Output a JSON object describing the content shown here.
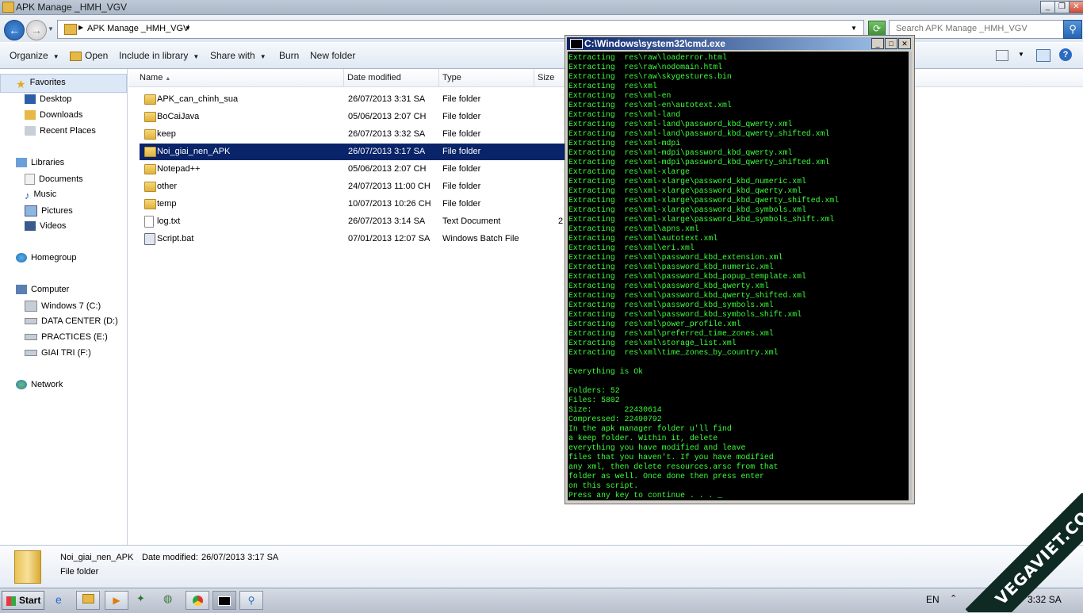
{
  "window": {
    "title": "APK Manage _HMH_VGV"
  },
  "address": {
    "path": "APK Manage _HMH_VGV"
  },
  "search": {
    "placeholder": "Search APK Manage _HMH_VGV"
  },
  "toolbar": {
    "organize": "Organize",
    "open": "Open",
    "include_in_library": "Include in library",
    "share_with": "Share with",
    "burn": "Burn",
    "new_folder": "New folder"
  },
  "nav": {
    "favorites": "Favorites",
    "desktop": "Desktop",
    "downloads": "Downloads",
    "recent_places": "Recent Places",
    "libraries": "Libraries",
    "documents": "Documents",
    "music": "Music",
    "pictures": "Pictures",
    "videos": "Videos",
    "homegroup": "Homegroup",
    "computer": "Computer",
    "drive_c": "Windows 7 (C:)",
    "drive_d": "DATA CENTER (D:)",
    "drive_e": "PRACTICES (E:)",
    "drive_f": "GIAI TRI (F:)",
    "network": "Network"
  },
  "columns": {
    "name": "Name",
    "date": "Date modified",
    "type": "Type",
    "size": "Size"
  },
  "files": [
    {
      "name": "APK_can_chinh_sua",
      "date": "26/07/2013 3:31 SA",
      "type": "File folder",
      "size": ""
    },
    {
      "name": "BoCaiJava",
      "date": "05/06/2013 2:07 CH",
      "type": "File folder",
      "size": ""
    },
    {
      "name": "keep",
      "date": "26/07/2013 3:32 SA",
      "type": "File folder",
      "size": ""
    },
    {
      "name": "Noi_giai_nen_APK",
      "date": "26/07/2013 3:17 SA",
      "type": "File folder",
      "size": ""
    },
    {
      "name": "Notepad++",
      "date": "05/06/2013 2:07 CH",
      "type": "File folder",
      "size": ""
    },
    {
      "name": "other",
      "date": "24/07/2013 11:00 CH",
      "type": "File folder",
      "size": ""
    },
    {
      "name": "temp",
      "date": "10/07/2013 10:26 CH",
      "type": "File folder",
      "size": ""
    },
    {
      "name": "log.txt",
      "date": "26/07/2013 3:14 SA",
      "type": "Text Document",
      "size": "2"
    },
    {
      "name": "Script.bat",
      "date": "07/01/2013 12:07 SA",
      "type": "Windows Batch File",
      "size": ""
    }
  ],
  "cmd": {
    "title": "C:\\Windows\\system32\\cmd.exe",
    "text": "Extracting  res\\raw\\loaderror.html\nExtracting  res\\raw\\nodomain.html\nExtracting  res\\raw\\skygestures.bin\nExtracting  res\\xml\nExtracting  res\\xml-en\nExtracting  res\\xml-en\\autotext.xml\nExtracting  res\\xml-land\nExtracting  res\\xml-land\\password_kbd_qwerty.xml\nExtracting  res\\xml-land\\password_kbd_qwerty_shifted.xml\nExtracting  res\\xml-mdpi\nExtracting  res\\xml-mdpi\\password_kbd_qwerty.xml\nExtracting  res\\xml-mdpi\\password_kbd_qwerty_shifted.xml\nExtracting  res\\xml-xlarge\nExtracting  res\\xml-xlarge\\password_kbd_numeric.xml\nExtracting  res\\xml-xlarge\\password_kbd_qwerty.xml\nExtracting  res\\xml-xlarge\\password_kbd_qwerty_shifted.xml\nExtracting  res\\xml-xlarge\\password_kbd_symbols.xml\nExtracting  res\\xml-xlarge\\password_kbd_symbols_shift.xml\nExtracting  res\\xml\\apns.xml\nExtracting  res\\xml\\autotext.xml\nExtracting  res\\xml\\eri.xml\nExtracting  res\\xml\\password_kbd_extension.xml\nExtracting  res\\xml\\password_kbd_numeric.xml\nExtracting  res\\xml\\password_kbd_popup_template.xml\nExtracting  res\\xml\\password_kbd_qwerty.xml\nExtracting  res\\xml\\password_kbd_qwerty_shifted.xml\nExtracting  res\\xml\\password_kbd_symbols.xml\nExtracting  res\\xml\\password_kbd_symbols_shift.xml\nExtracting  res\\xml\\power_profile.xml\nExtracting  res\\xml\\preferred_time_zones.xml\nExtracting  res\\xml\\storage_list.xml\nExtracting  res\\xml\\time_zones_by_country.xml\n\nEverything is Ok\n\nFolders: 52\nFiles: 5802\nSize:       22430614\nCompressed: 22490792\nIn the apk manager folder u'll find\na keep folder. Within it, delete\neverything you have modified and leave\nfiles that you haven't. If you have modified\nany xml, then delete resources.arsc from that\nfolder as well. Once done then press enter\non this script.\nPress any key to continue . . . _"
  },
  "details": {
    "name": "Noi_giai_nen_APK",
    "date_label": "Date modified:",
    "date_value": "26/07/2013 3:17 SA",
    "type": "File folder"
  },
  "taskbar": {
    "start": "Start",
    "lang": "EN",
    "clock": "3:32 SA"
  },
  "watermark": {
    "text": "VEGAVIET.COM"
  }
}
